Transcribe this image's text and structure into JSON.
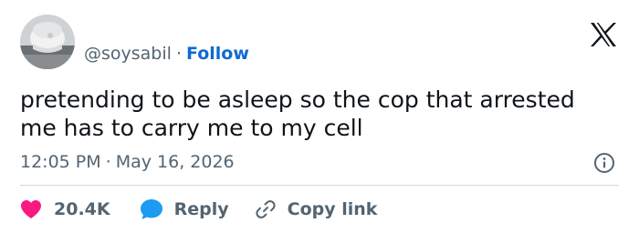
{
  "user": {
    "handle": "@soysabil",
    "separator": "·",
    "follow_label": "Follow"
  },
  "brand": {
    "logo_icon": "x-logo-icon"
  },
  "tweet": {
    "text": "pretending to be asleep so the cop that arrested me has to carry me to my cell",
    "time": "12:05 PM",
    "separator": "·",
    "date": "May 16, 2026"
  },
  "actions": {
    "likes": {
      "icon": "heart-icon",
      "count": "20.4K"
    },
    "reply": {
      "icon": "reply-bubble-icon",
      "label": "Reply"
    },
    "copy_link": {
      "icon": "link-icon",
      "label": "Copy link"
    }
  },
  "colors": {
    "text": "#0f1419",
    "secondary": "#536471",
    "follow": "#0f6ad3",
    "like": "#f91880",
    "reply": "#1d9bf0",
    "divider": "#cfd9de"
  }
}
